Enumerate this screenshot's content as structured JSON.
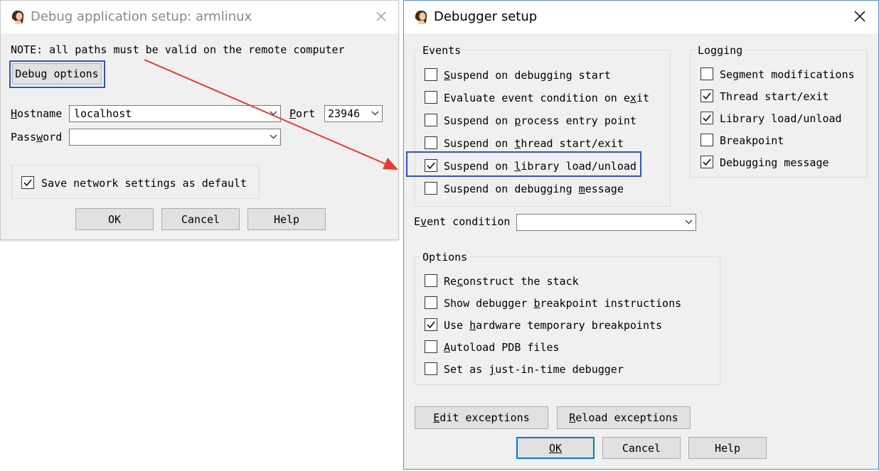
{
  "dialog1": {
    "title": "Debug application setup: armlinux",
    "note": "NOTE: all paths must be valid on the remote computer",
    "debug_options_button": "Debug options",
    "hostname_label": "Hostname",
    "hostname_value": "localhost",
    "port_label": "Port",
    "port_value": "23946",
    "password_label": "Password",
    "password_value": "",
    "save_network_label": "Save network settings as default",
    "save_network_checked": true,
    "ok": "OK",
    "cancel": "Cancel",
    "help": "Help"
  },
  "dialog2": {
    "title": "Debugger setup",
    "events": {
      "title": "Events",
      "items": [
        {
          "label": "Suspend on debugging start",
          "checked": false
        },
        {
          "label": "Evaluate event condition on exit",
          "checked": false
        },
        {
          "label": "Suspend on process entry point",
          "checked": false
        },
        {
          "label": "Suspend on thread start/exit",
          "checked": false
        },
        {
          "label": "Suspend on library load/unload",
          "checked": true
        },
        {
          "label": "Suspend on debugging message",
          "checked": false
        }
      ]
    },
    "logging": {
      "title": "Logging",
      "items": [
        {
          "label": "Segment modifications",
          "checked": false
        },
        {
          "label": "Thread start/exit",
          "checked": true
        },
        {
          "label": "Library load/unload",
          "checked": true
        },
        {
          "label": "Breakpoint",
          "checked": false
        },
        {
          "label": "Debugging message",
          "checked": true
        }
      ]
    },
    "event_condition_label": "Event condition",
    "event_condition_value": "",
    "options": {
      "title": "Options",
      "items": [
        {
          "label": "Reconstruct the stack",
          "checked": false
        },
        {
          "label": "Show debugger breakpoint instructions",
          "checked": false
        },
        {
          "label": "Use hardware temporary breakpoints",
          "checked": true
        },
        {
          "label": "Autoload PDB files",
          "checked": false
        },
        {
          "label": "Set as just-in-time debugger",
          "checked": false
        }
      ]
    },
    "edit_exceptions": "Edit exceptions",
    "reload_exceptions": "Reload exceptions",
    "ok": "OK",
    "cancel": "Cancel",
    "help": "Help"
  },
  "colors": {
    "highlight": "#2b54c9",
    "arrow": "#e8392f",
    "dialog_bg": "#f0f0f0"
  }
}
